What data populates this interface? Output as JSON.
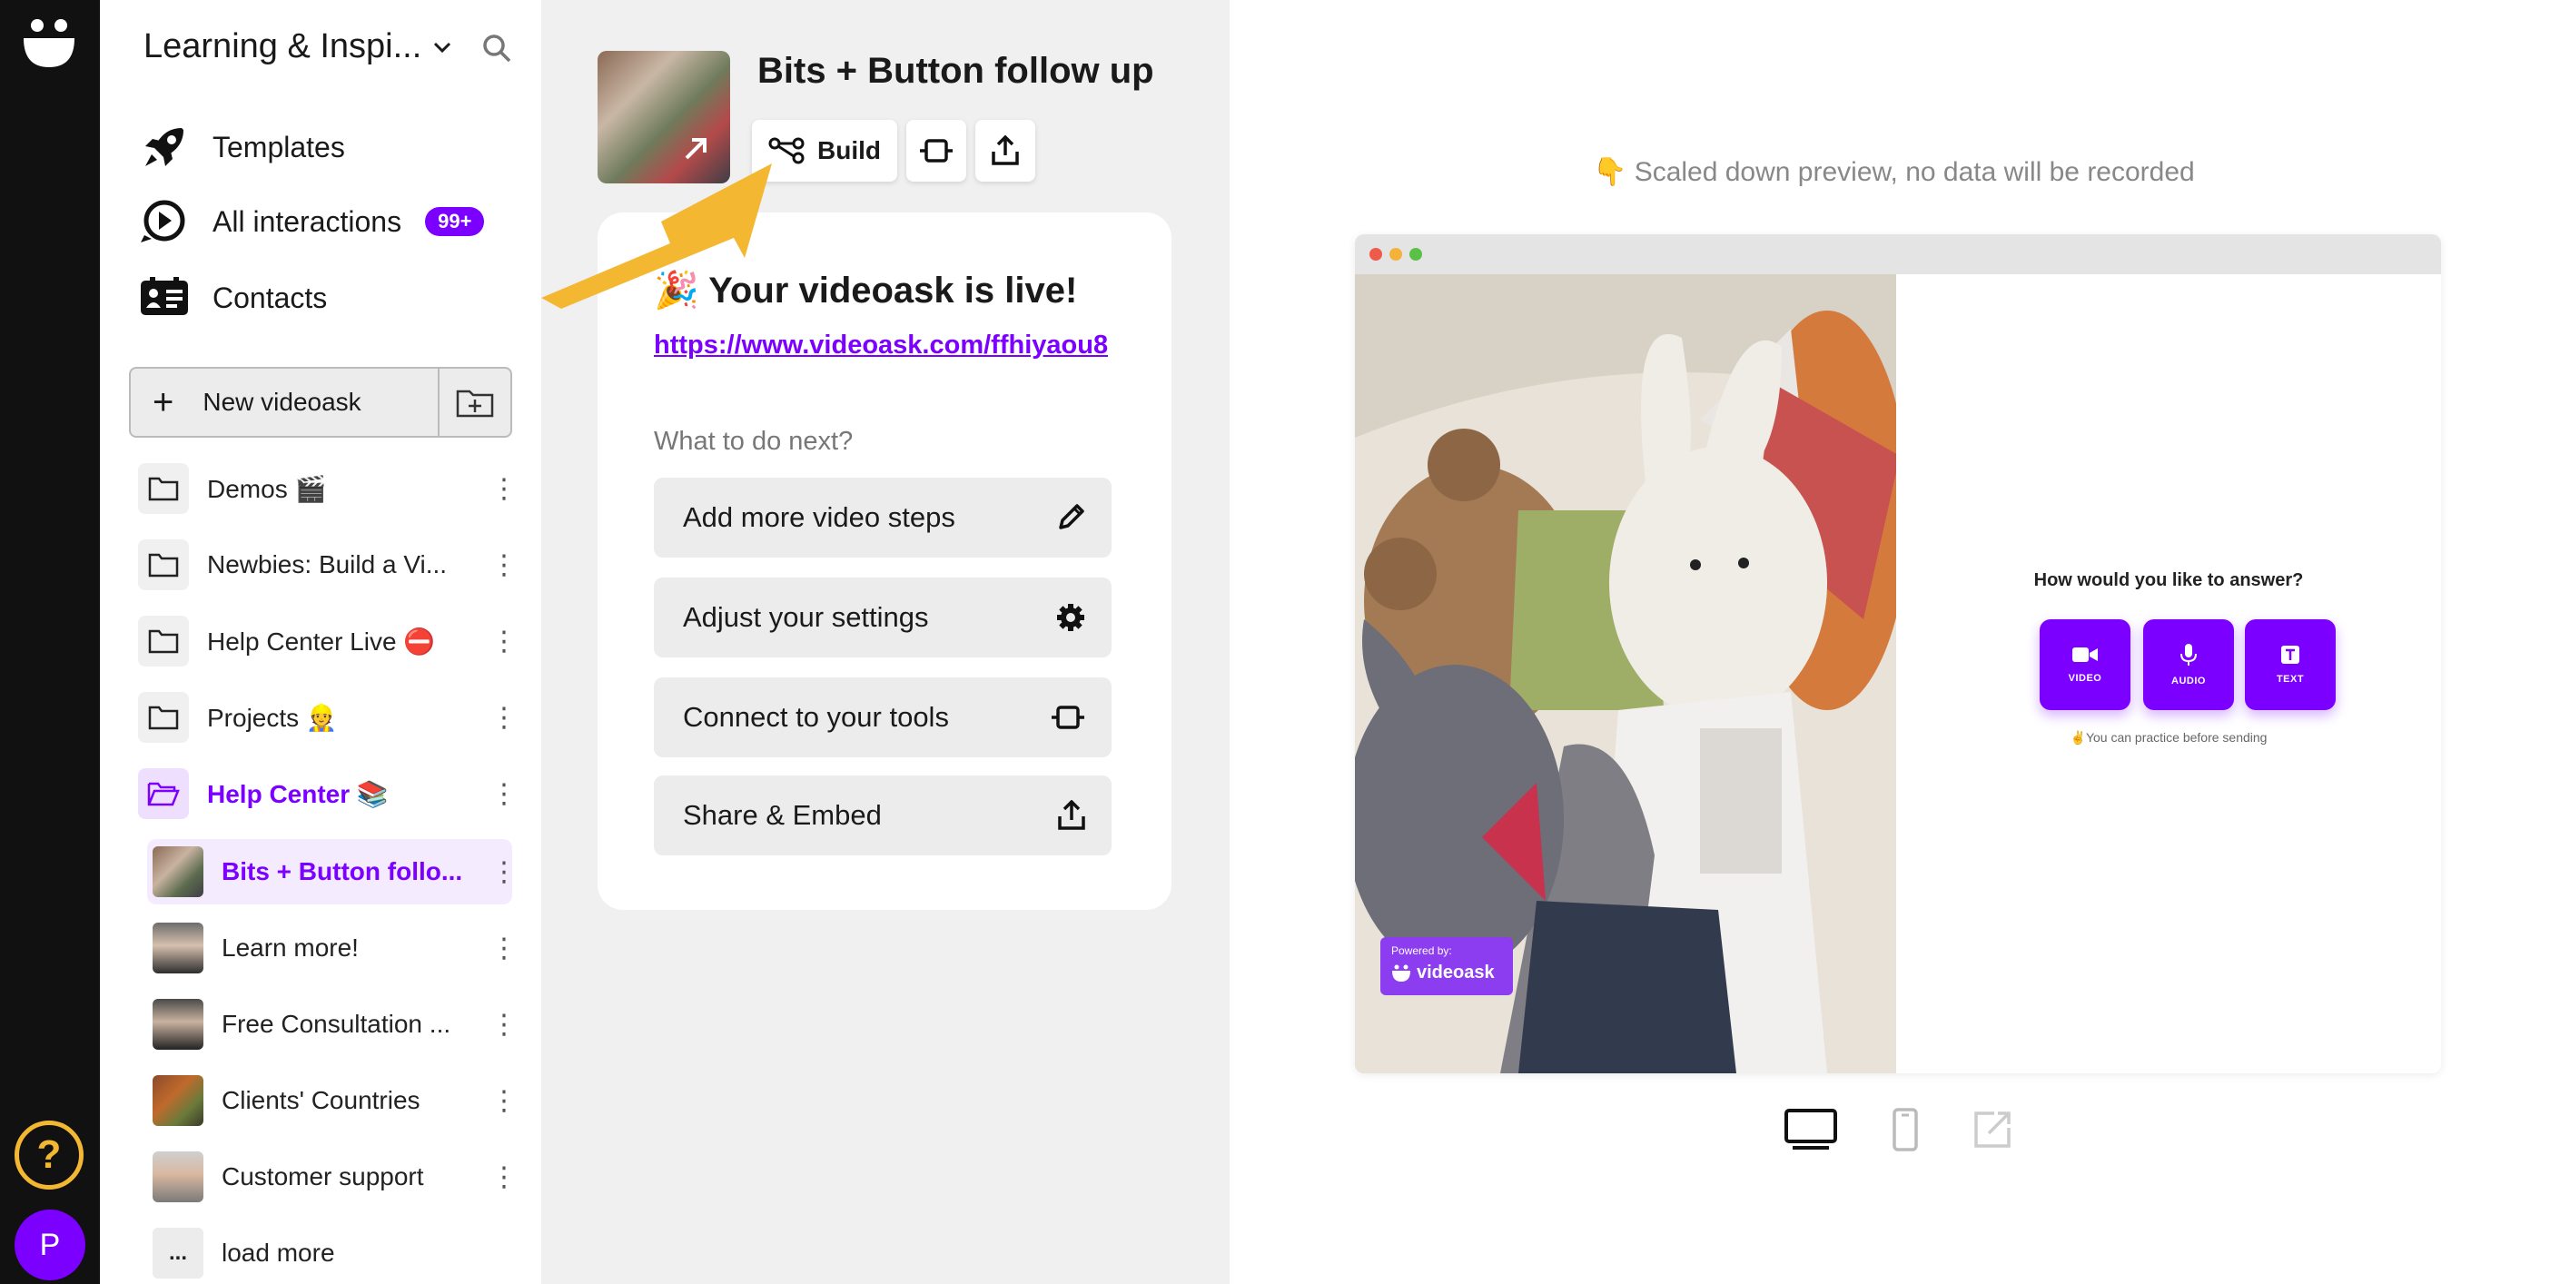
{
  "workspace": {
    "title": "Learning & Inspi..."
  },
  "nav": [
    {
      "label": "Templates",
      "icon": "rocket-icon"
    },
    {
      "label": "All interactions",
      "icon": "play-chat-icon",
      "badge": "99+"
    },
    {
      "label": "Contacts",
      "icon": "contacts-icon"
    }
  ],
  "new_button": {
    "label": "New videoask"
  },
  "folders": [
    {
      "label": "Demos 🎬"
    },
    {
      "label": "Newbies: Build a Vi..."
    },
    {
      "label": "Help Center Live ⛔"
    },
    {
      "label": "Projects 👷"
    },
    {
      "label": "Help Center 📚"
    }
  ],
  "videoasks": [
    {
      "label": "Bits + Button follo..."
    },
    {
      "label": "Learn more!"
    },
    {
      "label": "Free Consultation ..."
    },
    {
      "label": "Clients' Countries"
    },
    {
      "label": "Customer support"
    }
  ],
  "load_more": {
    "thumb": "...",
    "label": "load more"
  },
  "rail": {
    "help": "?",
    "avatar": "P"
  },
  "header": {
    "title": "Bits + Button follow up",
    "build_label": "Build"
  },
  "live": {
    "title": "🎉 Your videoask is live!",
    "link": "https://www.videoask.com/ffhiyaou8",
    "next_label": "What to do next?",
    "actions": [
      {
        "label": "Add more video steps",
        "icon": "pencil-icon"
      },
      {
        "label": "Adjust your settings",
        "icon": "gear-icon"
      },
      {
        "label": "Connect to your tools",
        "icon": "plug-icon"
      },
      {
        "label": "Share & Embed",
        "icon": "share-icon"
      }
    ]
  },
  "preview": {
    "note": "👇 Scaled down preview, no data will be recorded",
    "powered_by": "Powered by:",
    "brand": "videoask",
    "question": "How would you like to answer?",
    "options": [
      "VIDEO",
      "AUDIO",
      "TEXT"
    ],
    "practice": "✌️You can practice before sending"
  },
  "colors": {
    "accent": "#7b00ff",
    "arrow": "#f4b731",
    "rail": "#111111"
  }
}
